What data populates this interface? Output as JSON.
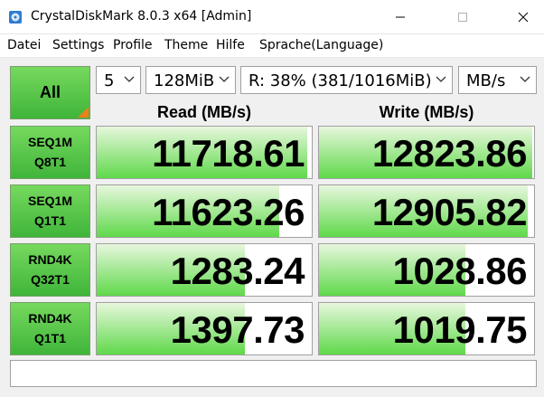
{
  "window": {
    "title": "CrystalDiskMark 8.0.3 x64 [Admin]"
  },
  "menu": [
    "Datei",
    "Settings",
    "Profile",
    "Theme",
    "Hilfe",
    "Sprache(Language)"
  ],
  "controls": {
    "all_label": "All",
    "count": "5",
    "size": "128MiB",
    "drive": "R: 38% (381/1016MiB)",
    "unit": "MB/s"
  },
  "headers": {
    "read": "Read (MB/s)",
    "write": "Write (MB/s)"
  },
  "colors": {
    "accent_green": "#3fb53a",
    "corner_orange": "#f07e1a"
  },
  "rows": [
    {
      "line1": "SEQ1M",
      "line2": "Q8T1",
      "read": "11718.61",
      "write": "12823.86",
      "read_fill": 0.98,
      "write_fill": 0.99
    },
    {
      "line1": "SEQ1M",
      "line2": "Q1T1",
      "read": "11623.26",
      "write": "12905.82",
      "read_fill": 0.85,
      "write_fill": 0.97
    },
    {
      "line1": "RND4K",
      "line2": "Q32T1",
      "read": "1283.24",
      "write": "1028.86",
      "read_fill": 0.69,
      "write_fill": 0.68
    },
    {
      "line1": "RND4K",
      "line2": "Q1T1",
      "read": "1397.73",
      "write": "1019.75",
      "read_fill": 0.69,
      "write_fill": 0.68
    }
  ],
  "comment": ""
}
